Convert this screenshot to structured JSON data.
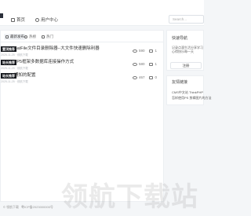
{
  "nav": {
    "home_label": "首页",
    "user_label": "用户中心",
    "search_placeholder": "Search..."
  },
  "tabs": [
    {
      "label": "最新发布",
      "active": true
    },
    {
      "label": "热榜",
      "active": false
    },
    {
      "label": "热门",
      "active": false
    }
  ],
  "posts": [
    {
      "tag": "置顶推荐",
      "title": "BatFile文件目录删除器--大文件快速删除利器",
      "meta": "2025-11-25 · 领航下载",
      "views": "590",
      "comments": "1"
    },
    {
      "tag": "站长推荐",
      "title": "TP5框架多数据库连接操作方式",
      "meta": "2025-11-25 · 领航下载",
      "views": "580",
      "comments": "1"
    },
    {
      "tag": "站长推荐",
      "title": "通知的配置",
      "meta": "2025-11-25 · 领航下载",
      "views": "467",
      "comments": "0"
    }
  ],
  "sidebar": {
    "card1": {
      "title": "快速导航",
      "text": "记录点滴生活分享学习心得快乐每一天",
      "button": "注册"
    },
    "card2": {
      "title": "友情链接",
      "links": [
        "CMS中文站 ThinkPHP",
        "怎样使用PS 剪辑图片的方法"
      ]
    }
  },
  "footer": {
    "copyright": "© 领航下载",
    "icp": "粤ICP备2023000000号"
  },
  "watermark": "领航下载站"
}
